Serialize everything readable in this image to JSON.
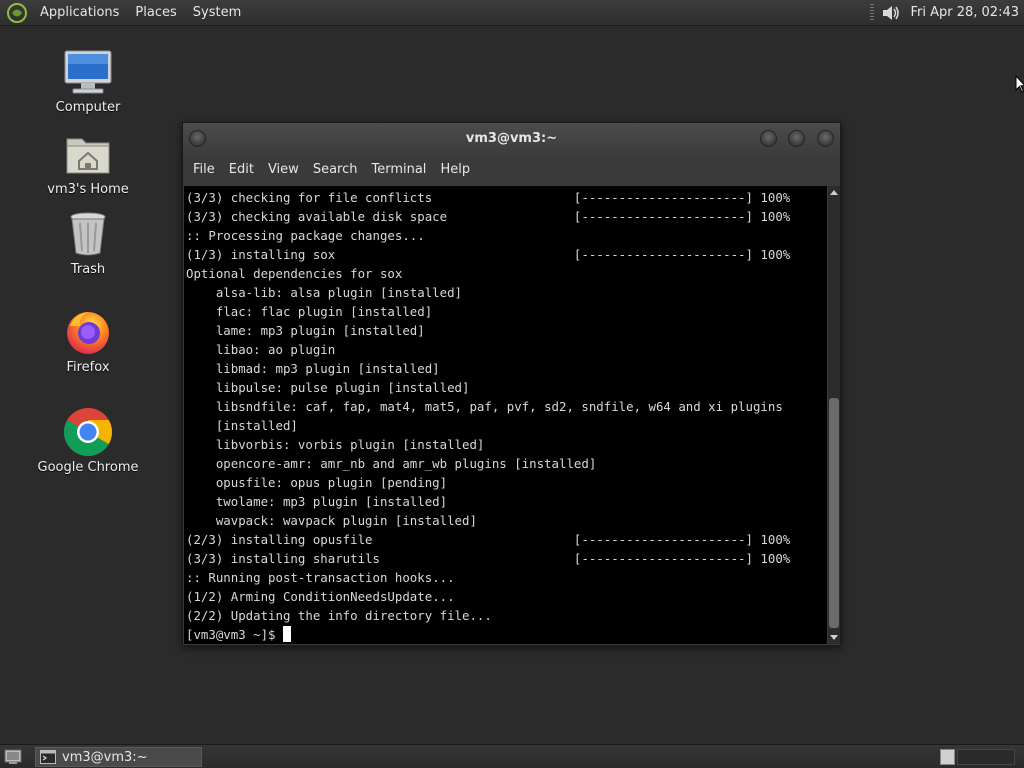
{
  "top_panel": {
    "menus": [
      "Applications",
      "Places",
      "System"
    ],
    "clock": "Fri Apr 28, 02:43"
  },
  "desktop": {
    "icons": [
      {
        "label": "Computer",
        "icon": "computer-icon"
      },
      {
        "label": "vm3's Home",
        "icon": "home-folder-icon"
      },
      {
        "label": "Trash",
        "icon": "trash-icon"
      },
      {
        "label": "Firefox",
        "icon": "firefox-icon"
      },
      {
        "label": "Google Chrome",
        "icon": "chrome-icon"
      }
    ]
  },
  "terminal": {
    "title": "vm3@vm3:~",
    "menu": [
      "File",
      "Edit",
      "View",
      "Search",
      "Terminal",
      "Help"
    ],
    "lines": [
      "(3/3) checking for file conflicts                   [----------------------] 100%",
      "(3/3) checking available disk space                 [----------------------] 100%",
      ":: Processing package changes...",
      "(1/3) installing sox                                [----------------------] 100%",
      "Optional dependencies for sox",
      "    alsa-lib: alsa plugin [installed]",
      "    flac: flac plugin [installed]",
      "    lame: mp3 plugin [installed]",
      "    libao: ao plugin",
      "    libmad: mp3 plugin [installed]",
      "    libpulse: pulse plugin [installed]",
      "    libsndfile: caf, fap, mat4, mat5, paf, pvf, sd2, sndfile, w64 and xi plugins",
      "    [installed]",
      "    libvorbis: vorbis plugin [installed]",
      "    opencore-amr: amr_nb and amr_wb plugins [installed]",
      "    opusfile: opus plugin [pending]",
      "    twolame: mp3 plugin [installed]",
      "    wavpack: wavpack plugin [installed]",
      "(2/3) installing opusfile                           [----------------------] 100%",
      "(3/3) installing sharutils                          [----------------------] 100%",
      ":: Running post-transaction hooks...",
      "(1/2) Arming ConditionNeedsUpdate...",
      "(2/2) Updating the info directory file..."
    ],
    "prompt": "[vm3@vm3 ~]$ "
  },
  "taskbar": {
    "window_button": "vm3@vm3:~"
  }
}
